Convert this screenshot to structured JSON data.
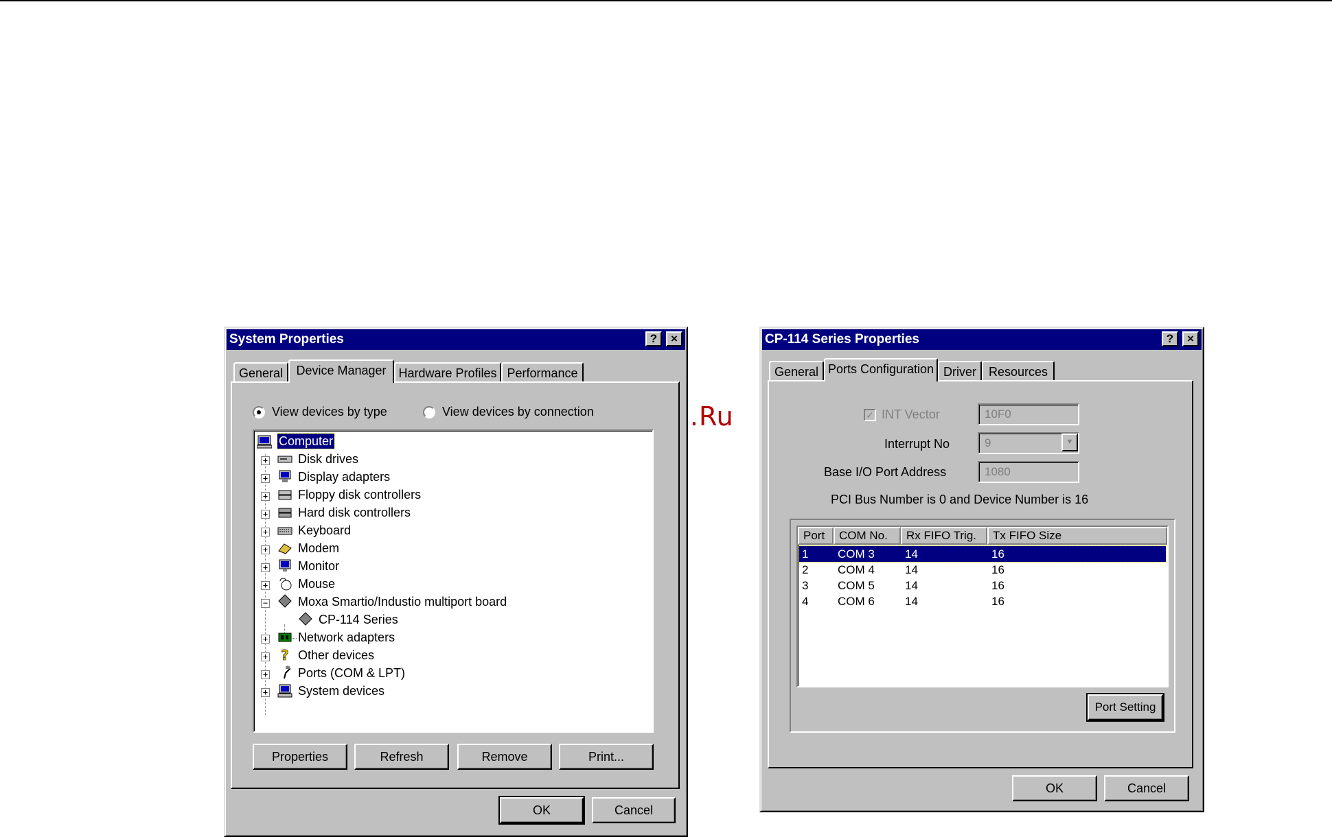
{
  "watermark": "McGrp.Ru",
  "system_properties": {
    "title": "System Properties",
    "help_btn": "?",
    "close_btn": "×",
    "tabs": [
      "General",
      "Device Manager",
      "Hardware Profiles",
      "Performance"
    ],
    "radio_by_type": "View devices by type",
    "radio_by_connection": "View devices by connection",
    "tree": {
      "root": "Computer",
      "items": [
        {
          "label": "Disk drives",
          "icon": "disk-drive-icon"
        },
        {
          "label": "Display adapters",
          "icon": "display-adapter-icon"
        },
        {
          "label": "Floppy disk controllers",
          "icon": "floppy-controller-icon"
        },
        {
          "label": "Hard disk controllers",
          "icon": "hard-disk-controller-icon"
        },
        {
          "label": "Keyboard",
          "icon": "keyboard-icon"
        },
        {
          "label": "Modem",
          "icon": "modem-icon"
        },
        {
          "label": "Monitor",
          "icon": "monitor-icon"
        },
        {
          "label": "Mouse",
          "icon": "mouse-icon"
        },
        {
          "label": "Moxa Smartio/Industio multiport board",
          "icon": "multiport-board-icon"
        },
        {
          "label": "CP-114 Series",
          "icon": "multiport-board-icon"
        },
        {
          "label": "Network adapters",
          "icon": "network-adapter-icon"
        },
        {
          "label": "Other devices",
          "icon": "question-mark-icon"
        },
        {
          "label": "Ports (COM & LPT)",
          "icon": "port-icon"
        },
        {
          "label": "System devices",
          "icon": "system-device-icon"
        }
      ]
    },
    "buttons": {
      "properties": "Properties",
      "refresh": "Refresh",
      "remove": "Remove",
      "print": "Print..."
    },
    "ok": "OK",
    "cancel": "Cancel"
  },
  "cp114": {
    "title": "CP-114 Series Properties",
    "help_btn": "?",
    "close_btn": "×",
    "tabs": [
      "General",
      "Ports Configuration",
      "Driver",
      "Resources"
    ],
    "int_vector_label": "INT Vector",
    "int_vector_value": "10F0",
    "interrupt_label": "Interrupt No",
    "interrupt_value": "9",
    "base_io_label": "Base I/O Port Address",
    "base_io_value": "1080",
    "pci_info": "PCI Bus Number is 0 and Device Number is 16",
    "columns": [
      "Port",
      "COM No.",
      "Rx FIFO Trig.",
      "Tx FIFO Size"
    ],
    "rows": [
      [
        "1",
        "COM 3",
        "14",
        "16"
      ],
      [
        "2",
        "COM 4",
        "14",
        "16"
      ],
      [
        "3",
        "COM 5",
        "14",
        "16"
      ],
      [
        "4",
        "COM 6",
        "14",
        "16"
      ]
    ],
    "port_setting": "Port Setting",
    "ok": "OK",
    "cancel": "Cancel"
  }
}
